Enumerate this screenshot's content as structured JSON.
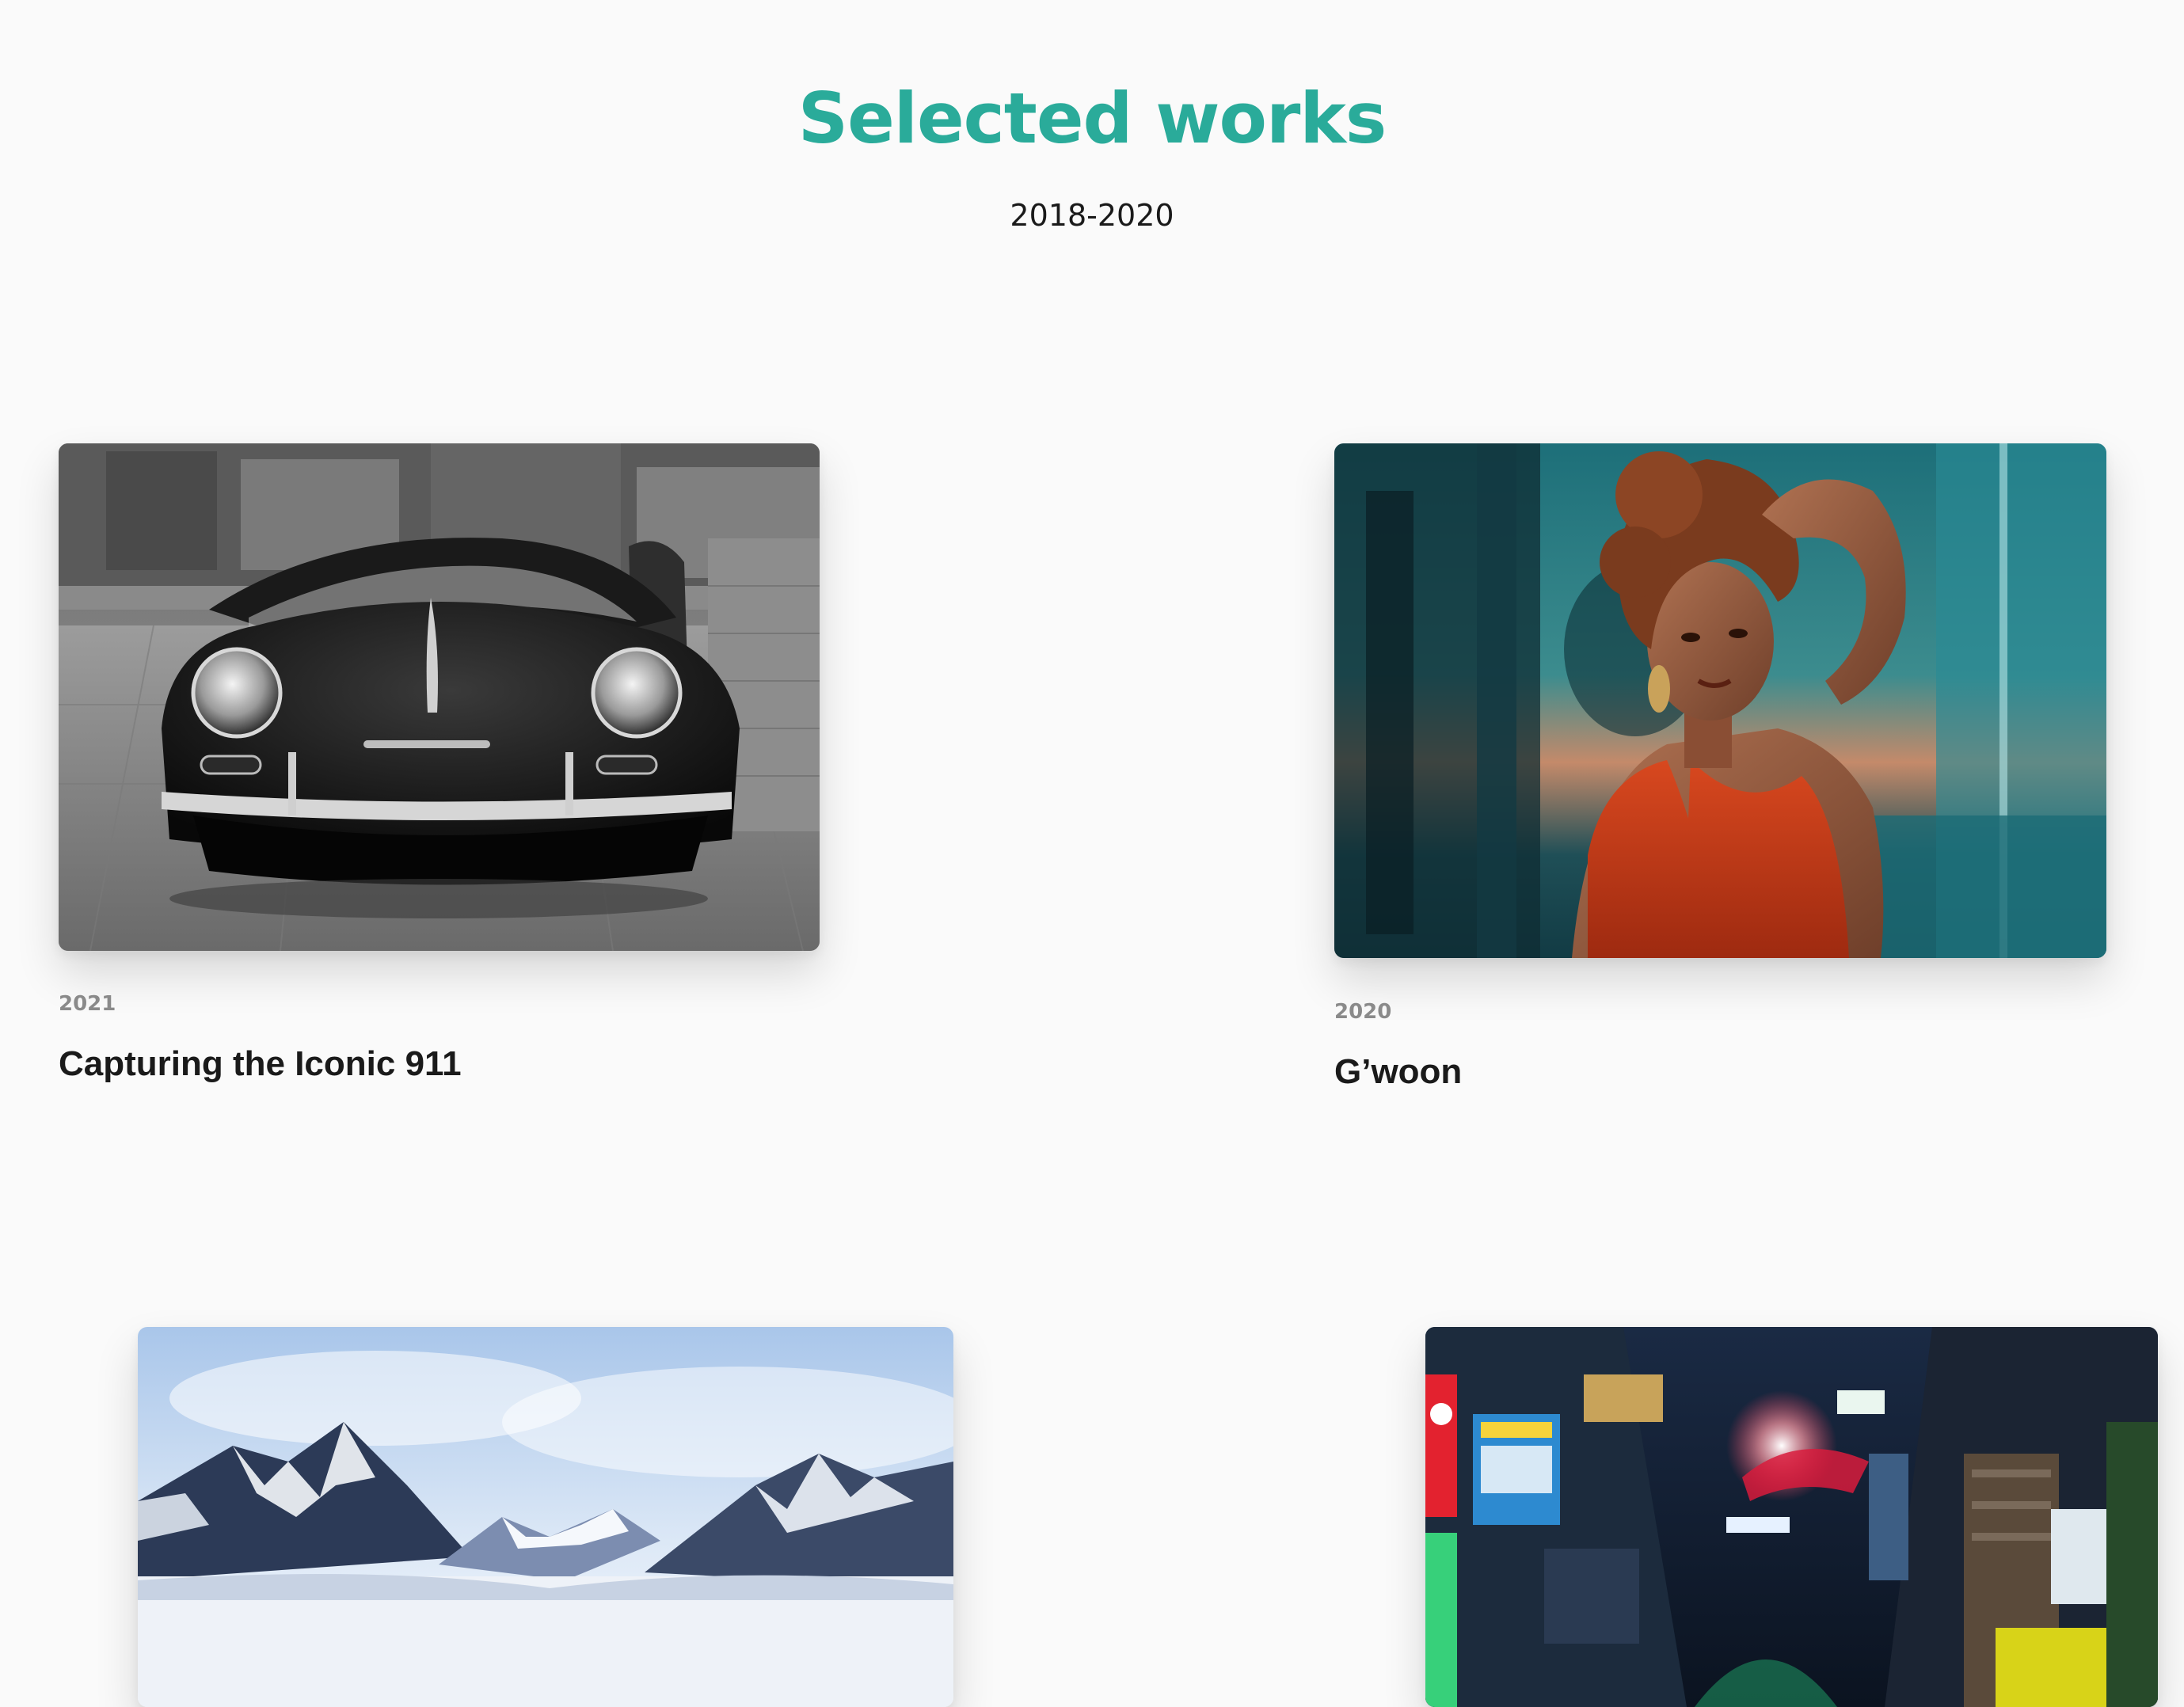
{
  "header": {
    "title": "Selected works",
    "subtitle": "2018-2020"
  },
  "works": [
    {
      "year": "2021",
      "title": "Capturing the Iconic 911",
      "image": "black-and-white-vintage-porsche-photo"
    },
    {
      "year": "2020",
      "title": "G’woon",
      "image": "woman-portrait-red-dress-photo"
    },
    {
      "image": "snowy-mountain-valley-photo"
    },
    {
      "image": "neon-night-alley-tokyo-photo"
    }
  ],
  "colors": {
    "accent": "#2aab9a",
    "background": "#fafafa",
    "text": "#1a1a1a",
    "muted": "#8a8a8a"
  }
}
